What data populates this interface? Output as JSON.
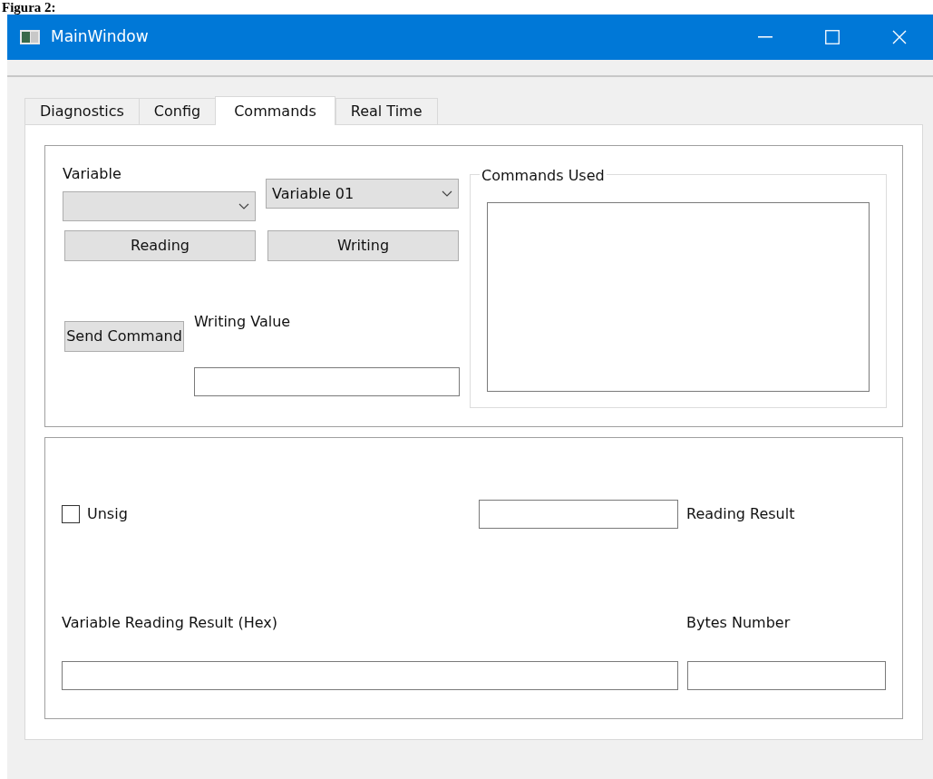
{
  "caption": "Figura 2:",
  "window": {
    "title": "MainWindow"
  },
  "tabs": [
    {
      "label": "Diagnostics",
      "selected": false
    },
    {
      "label": "Config",
      "selected": false
    },
    {
      "label": "Commands",
      "selected": true
    },
    {
      "label": "Real Time",
      "selected": false
    }
  ],
  "command_group": {
    "variable_label": "Variable",
    "second_select": {
      "value": "Variable 01"
    },
    "reading_button": "Reading",
    "writing_button": "Writing",
    "send_button": "Send Command",
    "writing_value_label": "Writing Value",
    "commands_used": {
      "title": "Commands Used"
    }
  },
  "result_group": {
    "unsig": {
      "label": "Unsig",
      "checked": false
    },
    "reading_result_label": "Reading Result",
    "hex_label": "Variable Reading Result (Hex)",
    "bytes_label": "Bytes Number"
  }
}
